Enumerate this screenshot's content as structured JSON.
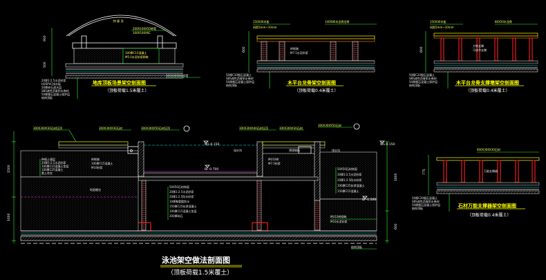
{
  "sections": {
    "s1": {
      "title": "地库顶板场景架空剖面图",
      "note": "（顶板荷载1.5米覆土）",
      "top_label": "拱 廊 顶",
      "callouts_top": [
        "200X100X50砖墙",
        "100X100X6C"
      ],
      "callouts_mid": [
        "100厚C15混凝土",
        "M5.0水泥砂浆砌筑"
      ],
      "callout_floor": "200X400X600墙",
      "layers": [
        "20厚1:2.5水泥砂浆",
        "H26PVC排水板",
        "50厚碎石滤水层",
        "SBS改性沥青防水卷材",
        "50厚细石混凝土保护层",
        "结构顶板"
      ],
      "dims": [
        "900",
        "500"
      ]
    },
    "s2": {
      "title": "木平台龙骨架空剖面图",
      "note": "（顶板荷载0.4米覆土）",
      "callouts_top": [
        "150X40木板",
        "间距5mm~10mm",
        "140X80木龙骨龙骨"
      ],
      "callouts_mid": [
        "砖砌墩",
        "M7.5水泥砂浆"
      ],
      "layers": [
        "50厚C20细石混凝土",
        "SBS改性沥青防水卷材",
        "50厚细石混凝土保护层",
        "结构顶板"
      ],
      "dims": [
        "600"
      ]
    },
    "s3": {
      "title": "木平台龙骨支撑墩架空剖面图",
      "note": "（顶板荷载0.4米覆土）",
      "callouts_top": [
        "150X40木板",
        "间距5mm~10mm",
        "80X50木龙骨"
      ],
      "callouts_mid": [
        "方钢支撑",
        "可调节支撑"
      ],
      "layers": [
        "50厚C20细石混凝土",
        "SBS改性沥青防水卷材",
        "50厚细石混凝土保护层",
        "结构顶板"
      ],
      "dims": [
        "600"
      ]
    },
    "s4": {
      "title": "石材万能支撑器架空剖面图",
      "note": "（顶板荷载0.4米覆土）",
      "callouts_top": [
        "600X300X30石材"
      ],
      "callouts_mid": [
        "万能支撑器"
      ],
      "layers": [
        "50厚C20细石混凝土",
        "SBS改性沥青防水卷材",
        "50厚细石混凝土保护层",
        "结构顶板"
      ],
      "dims": [
        "775"
      ]
    },
    "main": {
      "title": "泳池架空做法剖面图",
      "note": "（顶板荷载1.5米覆土）",
      "callouts_top": [
        "300X300X30石材压顶",
        "300X300X30石材",
        "300X300X50石材压顶",
        "300X300X40石材压顶",
        "300X300X30石材",
        "300X300X50石材"
      ],
      "levels": [
        "WL-0.150",
        "BF-0.700",
        "WL-0.150",
        "BF-1.500"
      ],
      "layers_left": [
        "种植土壤层",
        "20厚1:2.5水泥砂浆",
        "100厚C15混凝土垫层",
        "100厚C25混凝土",
        "素土夯实"
      ],
      "layers_mid": [
        "50X50石材饰面",
        "20厚1:2.5水泥砂浆",
        "20厚1:2.5防水砂浆",
        "10厚聚氨酯防水",
        "150厚C25抗渗混凝土",
        "100厚C15混凝土垫层",
        "200厚碎石"
      ],
      "layers_right": [
        "50X50石材饰面",
        "20厚1:2.5水泥砂浆",
        "20厚1:2.5防水砂浆",
        "100厚C25抗渗混凝土",
        "150厚C15混凝土"
      ],
      "misc_labels": [
        "砖砌墩",
        "100厚C15混凝土",
        "M10砂浆",
        "地面硬化",
        "溢水沟",
        "MU10砖",
        "M7.5砂浆",
        "预埋钢板",
        "排水沟",
        "MU10砖砌筑",
        "M10水泥砂浆",
        "结构顶板"
      ],
      "dims_left": [
        "1500",
        "1000"
      ],
      "dims_right": [
        "1600",
        "600"
      ]
    }
  }
}
